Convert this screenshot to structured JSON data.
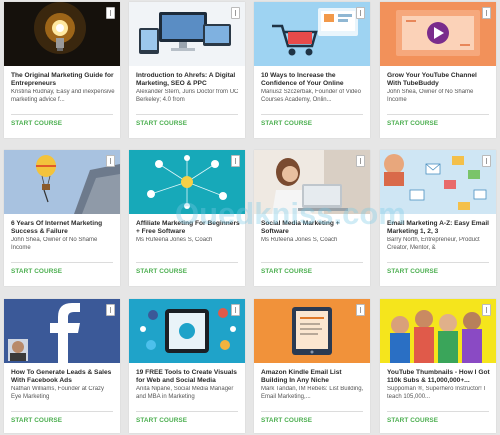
{
  "watermark": "Ouedkniss.com",
  "cta_color": "#4caf50",
  "courses": [
    {
      "title": "The Original Marketing Guide for Entrepreneurs",
      "description": "Kristina Rudnay, Easy and inexpensive marketing advice f...",
      "cta": "START COURSE",
      "thumbnail": "lightbulb"
    },
    {
      "title": "Introduction to Ahrefs: A Digital Marketing, SEO & PPC",
      "description": "Alexander Stern, Juris Doctor from UC Berkeley; 4.0 from",
      "cta": "START COURSE",
      "thumbnail": "devices"
    },
    {
      "title": "10 Ways to Increase the Confidence of Your Online",
      "description": "Mariusz Szczerbak, Founder of Video Courses Academy, Onlin...",
      "cta": "START COURSE",
      "thumbnail": "shopping-cart"
    },
    {
      "title": "Grow Your YouTube Channel With TubeBuddy",
      "description": "John Shea, Owner of No Shame Income",
      "cta": "START COURSE",
      "thumbnail": "tubebuddy"
    },
    {
      "title": "6 Years Of Internet Marketing Success & Failure",
      "description": "John Shea, Owner of No Shame Income",
      "cta": "START COURSE",
      "thumbnail": "balloon"
    },
    {
      "title": "Affiliate Marketing For Beginners + Free Software",
      "description": "Ms Rufeena Jones S, Coach",
      "cta": "START COURSE",
      "thumbnail": "network"
    },
    {
      "title": "Social Media Marketing + Software",
      "description": "Ms Rufeena Jones S, Coach",
      "cta": "START COURSE",
      "thumbnail": "laptop-user"
    },
    {
      "title": "Email Marketing A-Z: Easy Email Marketing 1, 2, 3",
      "description": "Barry North, Entrepreneur, Product Creator, Mentor, &",
      "cta": "START COURSE",
      "thumbnail": "email"
    },
    {
      "title": "How To Generate Leads & Sales With Facebook Ads",
      "description": "Nathan Williams, Founder at Crazy Eye Marketing",
      "cta": "START COURSE",
      "thumbnail": "facebook"
    },
    {
      "title": "19 FREE Tools to Create Visuals for Web and Social Media",
      "description": "Anita Nipane, Social Media Manager and MBA in Marketing",
      "cta": "START COURSE",
      "thumbnail": "tablet-social"
    },
    {
      "title": "Amazon Kindle Email List Building In Any Niche",
      "description": "Mark Tandan, IM Rebels: List Building, Email Marketing,...",
      "cta": "START COURSE",
      "thumbnail": "ebook"
    },
    {
      "title": "YouTube Thumbnails - How I Got 110k Subs & 11,000,000+...",
      "description": "Suppoman ®, Superhero Instructor! I teach 105,000...",
      "cta": "START COURSE",
      "thumbnail": "people"
    }
  ]
}
